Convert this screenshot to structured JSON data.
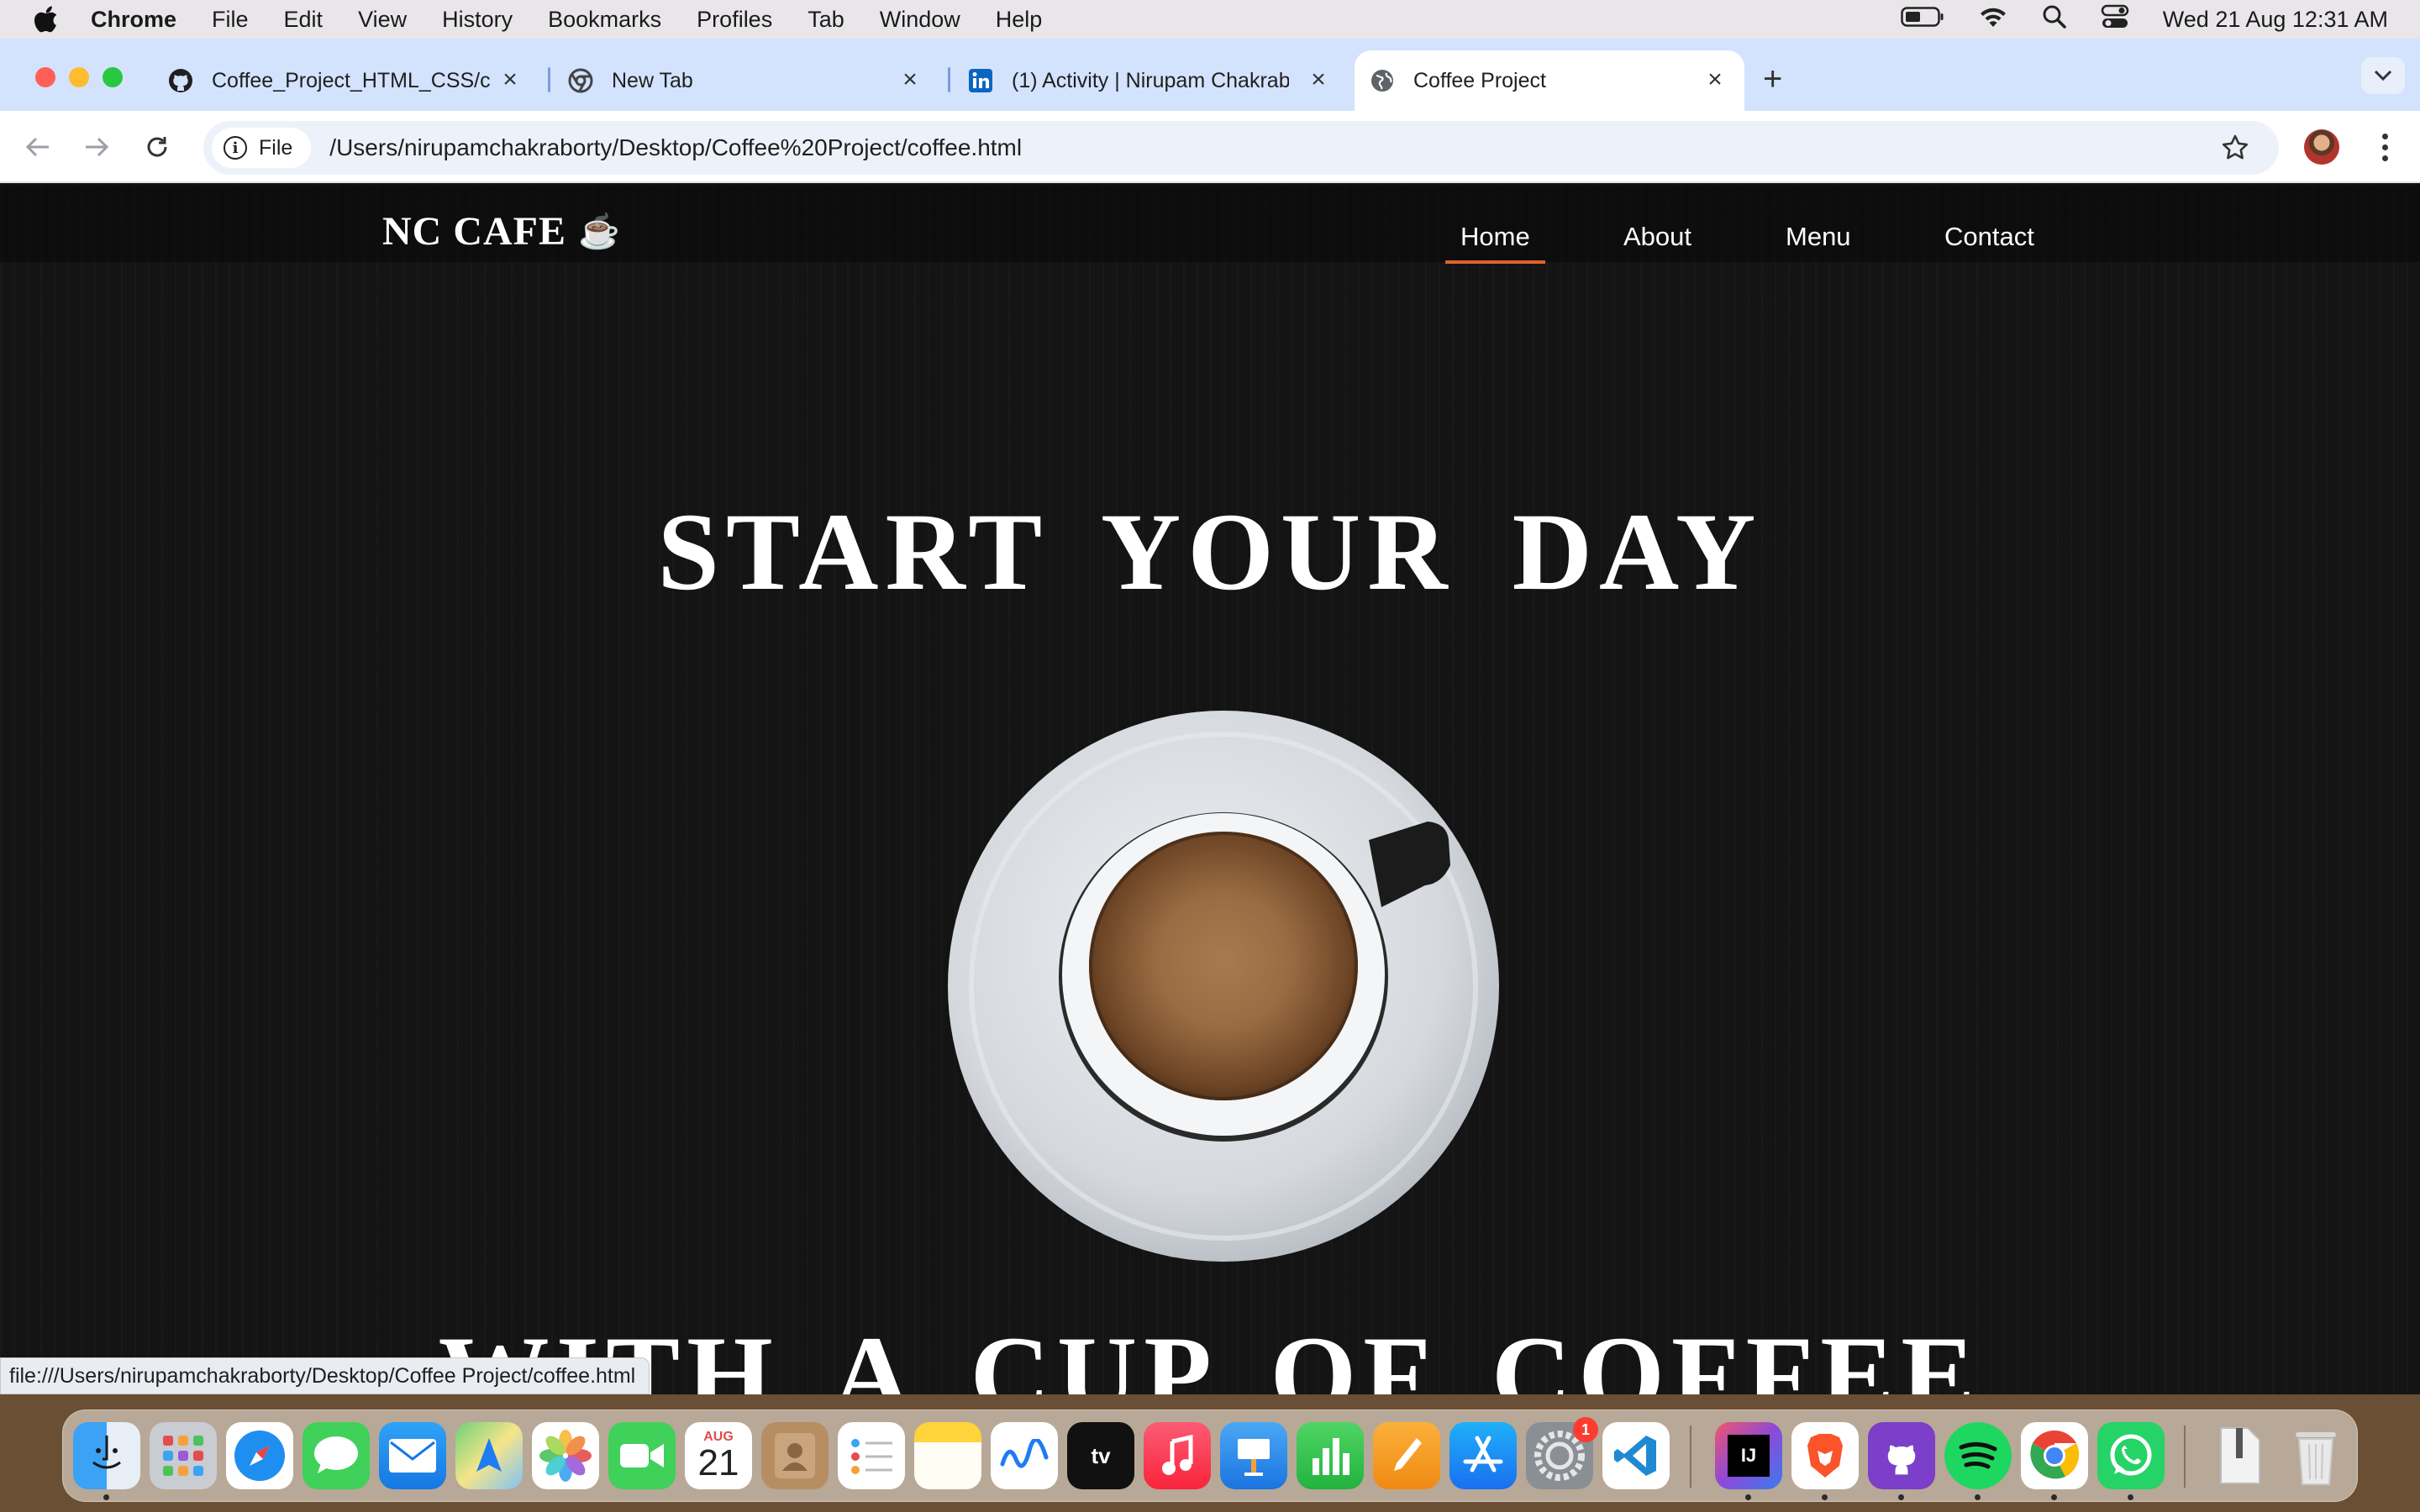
{
  "menubar": {
    "app_name": "Chrome",
    "items": [
      "File",
      "Edit",
      "View",
      "History",
      "Bookmarks",
      "Profiles",
      "Tab",
      "Window",
      "Help"
    ],
    "datetime": "Wed 21 Aug  12:31 AM"
  },
  "tabs": [
    {
      "title": "Coffee_Project_HTML_CSS/c",
      "icon": "github-icon",
      "active": false
    },
    {
      "title": "New Tab",
      "icon": "chrome-icon",
      "active": false
    },
    {
      "title": "(1) Activity | Nirupam Chakrab",
      "icon": "linkedin-icon",
      "active": false
    },
    {
      "title": "Coffee Project",
      "icon": "globe-icon",
      "active": true
    }
  ],
  "toolbar": {
    "site_chip": "File",
    "url": "/Users/nirupamchakraborty/Desktop/Coffee%20Project/coffee.html"
  },
  "site": {
    "brand": "NC CAFE",
    "brand_emoji": "☕",
    "nav": [
      "Home",
      "About",
      "Menu",
      "Contact"
    ],
    "active_nav": "Home",
    "headline_1": "START YOUR DAY",
    "headline_2": "WITH A CUP OF COFFEE"
  },
  "status_bar": "file:///Users/nirupamchakraborty/Desktop/Coffee Project/coffee.html",
  "dock": {
    "calendar_month": "AUG",
    "calendar_day": "21",
    "settings_badge": "1",
    "intellij_label": "IJ"
  },
  "colors": {
    "nav_active_underline": "#e0612a",
    "tabstrip": "#d3e3fd",
    "page_bg": "#141414"
  }
}
